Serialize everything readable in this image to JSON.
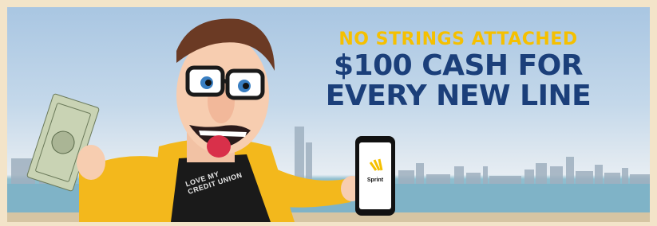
{
  "headline": {
    "line1": "NO STRINGS ATTACHED",
    "line2": "$100 CASH FOR",
    "line3": "EVERY NEW LINE"
  },
  "phone": {
    "brand": "Sprint"
  },
  "shirt": {
    "text": "LOVE MY CREDIT UNION"
  },
  "colors": {
    "accent_yellow": "#f5c000",
    "navy": "#1b3f7a",
    "border": "#f3e4c9",
    "jacket": "#f3b81c"
  }
}
